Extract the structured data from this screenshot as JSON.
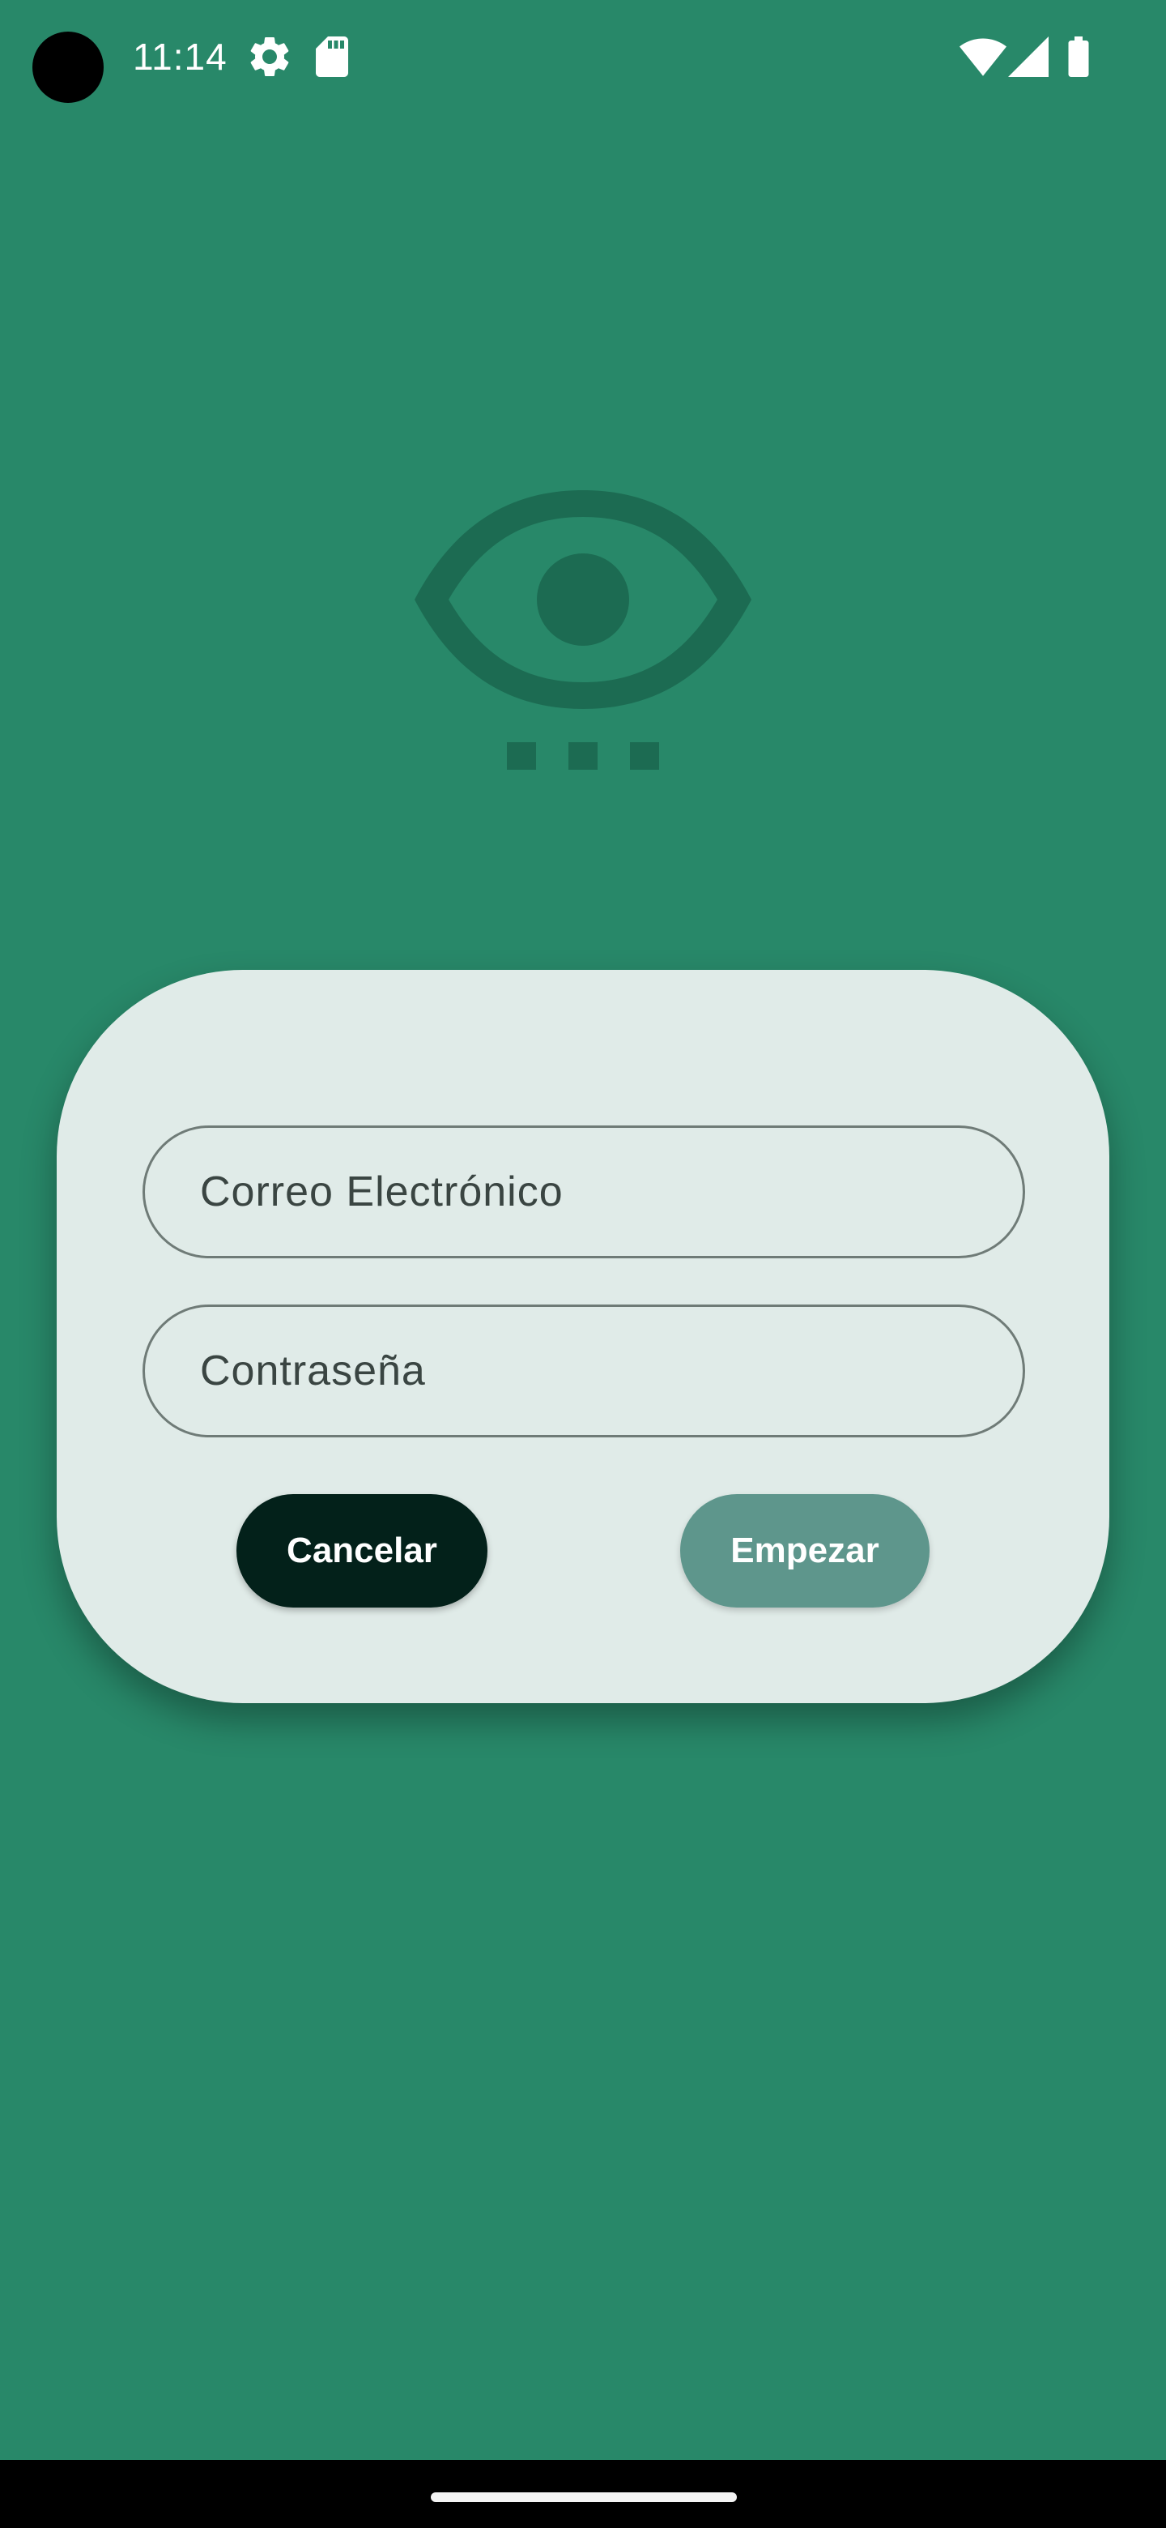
{
  "status_bar": {
    "time": "11:14",
    "left_icons": [
      "settings-gear-icon",
      "sd-card-icon"
    ],
    "right_icons": [
      "wifi-icon",
      "cellular-signal-icon",
      "battery-icon"
    ]
  },
  "logo": {
    "icon": "eye-with-dots-icon"
  },
  "login_dialog": {
    "email_placeholder": "Correo Electrónico",
    "password_placeholder": "Contraseña",
    "cancel_label": "Cancelar",
    "start_label": "Empezar"
  },
  "colors": {
    "background": "#288869",
    "dialog_background": "#e0ebe8",
    "cancel_button": "#03211a",
    "start_button": "#5e968c",
    "logo_tint": "#1c6b52"
  }
}
